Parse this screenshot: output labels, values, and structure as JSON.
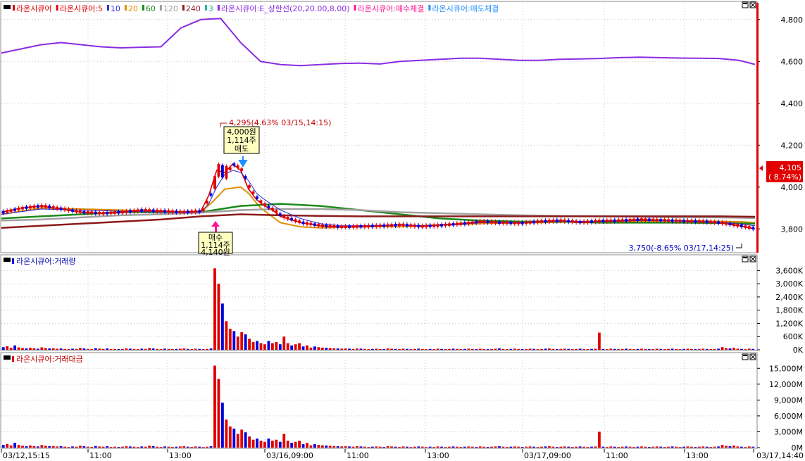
{
  "colors": {
    "up": "#e00000",
    "down": "#0000e0",
    "ma3": "#e00000",
    "ma5": "#e00000",
    "ma10": "#2a2ae0",
    "ma20": "#e09000",
    "ma60": "#1a8a1a",
    "ma120": "#a0a0a0",
    "ma240": "#8b1a1a",
    "upper_limit": "#8a2be2",
    "buy_marker": "#ff1493",
    "sell_marker": "#1e90ff",
    "grid": "#c8c8c8"
  },
  "legend": {
    "price": [
      {
        "text": "라온시큐어",
        "color": "#e00000"
      },
      {
        "text": "라온시큐어:5",
        "color": "#e00000"
      },
      {
        "text": "10",
        "color": "#2a2ae0"
      },
      {
        "text": "20",
        "color": "#e09000"
      },
      {
        "text": "60",
        "color": "#1a8a1a"
      },
      {
        "text": "120",
        "color": "#a0a0a0"
      },
      {
        "text": "240",
        "color": "#8b1a1a"
      },
      {
        "text": "3",
        "color": "#20b2aa"
      },
      {
        "text": "라온시큐어:E_상한선(20,20.00,8.00)",
        "color": "#8a2be2"
      },
      {
        "text": "라온시큐어:매수체결",
        "color": "#ff1493"
      },
      {
        "text": "라온시큐어:매도체결",
        "color": "#1e90ff"
      }
    ],
    "volume": "라온시큐어:거래량",
    "amount": "라온시큐어:거래대금"
  },
  "chart_data": [
    {
      "type": "line",
      "panel": "price",
      "y_axis_ticks": [
        "4,800",
        "4,600",
        "4,400",
        "4,200",
        "4,000",
        "3,800"
      ],
      "ylim": [
        3,
        690,
        4,
        880
      ],
      "current_price": "4,105",
      "current_change": "( 8.74%)",
      "high_label": "4,295(4.63% 03/15,14:15)",
      "low_label": "3,750(-8.65% 03/17,14:25)",
      "buy_annotation": [
        "매수",
        "1,114주",
        "4,140원"
      ],
      "sell_annotation": [
        "4,000원",
        "1,114주",
        "매도"
      ],
      "series": [
        {
          "name": "라온시큐어:E_상한선(20,20.00,8.00)",
          "x": [
            0,
            5,
            10,
            15,
            20,
            25,
            30,
            35,
            40,
            45,
            50,
            55,
            60,
            65,
            70,
            75,
            80,
            85,
            90,
            95,
            100,
            105,
            110,
            115,
            120,
            125,
            130,
            135,
            140,
            145,
            150,
            155,
            160,
            165,
            170,
            175,
            180,
            185,
            189
          ],
          "values": [
            4640,
            4660,
            4680,
            4690,
            4680,
            4670,
            4665,
            4668,
            4670,
            4760,
            4800,
            4805,
            4690,
            4600,
            4585,
            4580,
            4585,
            4590,
            4592,
            4588,
            4600,
            4605,
            4610,
            4615,
            4615,
            4610,
            4605,
            4605,
            4610,
            4612,
            4614,
            4618,
            4620,
            4618,
            4616,
            4615,
            4614,
            4605,
            4586
          ]
        },
        {
          "name": "20",
          "x": [
            0,
            10,
            20,
            30,
            40,
            50,
            53,
            56,
            60,
            62,
            65,
            70,
            75,
            80,
            85,
            90,
            95,
            100,
            105,
            110,
            115,
            120,
            125,
            130,
            135,
            140,
            145,
            150,
            155,
            160,
            165,
            170,
            175,
            180,
            185,
            189
          ],
          "values": [
            3870,
            3900,
            3895,
            3890,
            3885,
            3880,
            3930,
            3990,
            4000,
            3970,
            3900,
            3830,
            3810,
            3805,
            3808,
            3810,
            3812,
            3810,
            3815,
            3820,
            3822,
            3825,
            3828,
            3830,
            3830,
            3832,
            3835,
            3835,
            3834,
            3836,
            3838,
            3840,
            3838,
            3836,
            3835,
            3830
          ]
        },
        {
          "name": "60",
          "x": [
            0,
            10,
            20,
            30,
            40,
            50,
            60,
            70,
            80,
            90,
            100,
            110,
            120,
            130,
            140,
            150,
            160,
            170,
            180,
            189
          ],
          "values": [
            3850,
            3860,
            3870,
            3880,
            3880,
            3880,
            3910,
            3920,
            3910,
            3890,
            3870,
            3850,
            3840,
            3835,
            3835,
            3830,
            3830,
            3830,
            3828,
            3825
          ]
        },
        {
          "name": "120",
          "x": [
            0,
            10,
            20,
            30,
            40,
            50,
            60,
            70,
            80,
            90,
            100,
            110,
            120,
            130,
            140,
            150,
            160,
            170,
            180,
            189
          ],
          "values": [
            3840,
            3845,
            3855,
            3865,
            3870,
            3878,
            3890,
            3895,
            3895,
            3890,
            3880,
            3875,
            3870,
            3865,
            3862,
            3860,
            3858,
            3856,
            3855,
            3852
          ]
        },
        {
          "name": "240",
          "x": [
            0,
            10,
            20,
            30,
            40,
            50,
            60,
            70,
            80,
            90,
            100,
            110,
            120,
            130,
            140,
            150,
            160,
            170,
            180,
            189
          ],
          "values": [
            3805,
            3815,
            3825,
            3835,
            3845,
            3860,
            3870,
            3865,
            3862,
            3860,
            3860,
            3860,
            3860,
            3860,
            3860,
            3860,
            3860,
            3860,
            3860,
            3858
          ]
        },
        {
          "name": "라온시큐어:5",
          "x": [
            0,
            5,
            10,
            15,
            20,
            25,
            30,
            35,
            40,
            45,
            50,
            52,
            54,
            56,
            58,
            60,
            62,
            64,
            66,
            68,
            70,
            75,
            80,
            85,
            90,
            95,
            100,
            105,
            110,
            115,
            120,
            125,
            130,
            135,
            140,
            145,
            150,
            155,
            160,
            165,
            170,
            175,
            180,
            185,
            189
          ],
          "values": [
            3880,
            3900,
            3910,
            3895,
            3880,
            3875,
            3880,
            3890,
            3885,
            3880,
            3885,
            3960,
            4080,
            4070,
            4110,
            4080,
            3990,
            3940,
            3910,
            3890,
            3860,
            3830,
            3815,
            3810,
            3812,
            3815,
            3820,
            3812,
            3818,
            3825,
            3835,
            3830,
            3828,
            3836,
            3840,
            3832,
            3838,
            3840,
            3845,
            3842,
            3838,
            3836,
            3830,
            3815,
            3800
          ]
        },
        {
          "name": "10",
          "x": [
            0,
            10,
            20,
            30,
            40,
            50,
            52,
            54,
            56,
            58,
            60,
            62,
            64,
            66,
            68,
            70,
            75,
            80,
            85,
            90,
            95,
            100,
            105,
            110,
            115,
            120,
            125,
            130,
            135,
            140,
            145,
            150,
            155,
            160,
            165,
            170,
            175,
            180,
            185,
            189
          ],
          "values": [
            3870,
            3895,
            3890,
            3885,
            3880,
            3880,
            3920,
            4000,
            4060,
            4080,
            4070,
            4030,
            3970,
            3940,
            3915,
            3890,
            3850,
            3825,
            3815,
            3815,
            3816,
            3818,
            3816,
            3818,
            3822,
            3830,
            3832,
            3830,
            3834,
            3838,
            3836,
            3836,
            3838,
            3840,
            3840,
            3838,
            3836,
            3832,
            3824,
            3815
          ]
        }
      ]
    },
    {
      "type": "bar",
      "panel": "volume",
      "y_axis_ticks": [
        "3,600K",
        "3,000K",
        "2,400K",
        "1,800K",
        "1,200K",
        "600K",
        "0K"
      ],
      "ylim": [
        0,
        3900
      ],
      "units": "K",
      "values": [
        120,
        160,
        90,
        200,
        110,
        80,
        60,
        90,
        70,
        50,
        110,
        80,
        60,
        70,
        50,
        60,
        40,
        30,
        50,
        40,
        80,
        60,
        40,
        30,
        70,
        50,
        40,
        60,
        30,
        40,
        30,
        40,
        60,
        50,
        40,
        30,
        50,
        40,
        80,
        60,
        40,
        30,
        50,
        40,
        30,
        40,
        50,
        60,
        40,
        30,
        50,
        40,
        30,
        40,
        60,
        3700,
        3000,
        2100,
        1300,
        950,
        850,
        600,
        800,
        700,
        500,
        350,
        400,
        300,
        250,
        400,
        300,
        350,
        250,
        600,
        300,
        200,
        250,
        300,
        150,
        200,
        100,
        150,
        120,
        100,
        90,
        80,
        70,
        60,
        50,
        60,
        50,
        40,
        60,
        50,
        40,
        30,
        40,
        50,
        40,
        30,
        60,
        50,
        40,
        30,
        50,
        40,
        30,
        40,
        50,
        40,
        30,
        40,
        30,
        50,
        40,
        30,
        40,
        50,
        40,
        30,
        40,
        50,
        40,
        30,
        50,
        40,
        30,
        40,
        50,
        60,
        40,
        30,
        40,
        50,
        40,
        30,
        40,
        50,
        40,
        30,
        40,
        50,
        60,
        40,
        30,
        40,
        50,
        40,
        30,
        40,
        50,
        40,
        30,
        40,
        50,
        780,
        40,
        30,
        50,
        40,
        30,
        40,
        50,
        40,
        30,
        40,
        50,
        40,
        30,
        40,
        50,
        40,
        30,
        40,
        50,
        40,
        30,
        40,
        50,
        40,
        30,
        40,
        50,
        40,
        30,
        40,
        50,
        120,
        80,
        60,
        90,
        50,
        40,
        30,
        50,
        40
      ],
      "colors": "ud"
    },
    {
      "type": "bar",
      "panel": "amount",
      "y_axis_ticks": [
        "15,000M",
        "12,000M",
        "9,000M",
        "6,000M",
        "3,000M",
        "0M"
      ],
      "ylim": [
        0,
        16500
      ],
      "units": "M",
      "values": [
        500,
        700,
        400,
        900,
        500,
        350,
        260,
        400,
        300,
        220,
        480,
        350,
        260,
        300,
        220,
        260,
        180,
        130,
        220,
        180,
        350,
        260,
        180,
        130,
        300,
        220,
        180,
        260,
        130,
        180,
        130,
        180,
        260,
        220,
        180,
        130,
        220,
        180,
        350,
        260,
        180,
        130,
        220,
        180,
        130,
        180,
        220,
        260,
        180,
        130,
        220,
        180,
        130,
        180,
        260,
        15500,
        13000,
        8500,
        5300,
        4000,
        3600,
        2600,
        3400,
        2900,
        2100,
        1500,
        1700,
        1300,
        1100,
        1700,
        1300,
        1500,
        1100,
        2600,
        1300,
        900,
        1100,
        1300,
        650,
        900,
        430,
        650,
        520,
        430,
        390,
        350,
        300,
        260,
        220,
        260,
        220,
        180,
        260,
        220,
        180,
        130,
        180,
        220,
        180,
        130,
        260,
        220,
        180,
        130,
        220,
        180,
        130,
        180,
        220,
        180,
        130,
        180,
        130,
        220,
        180,
        130,
        180,
        220,
        180,
        130,
        180,
        220,
        180,
        130,
        220,
        180,
        130,
        180,
        220,
        260,
        180,
        130,
        180,
        220,
        180,
        130,
        180,
        220,
        180,
        130,
        180,
        220,
        260,
        180,
        130,
        180,
        220,
        180,
        130,
        180,
        220,
        180,
        130,
        180,
        220,
        3000,
        180,
        130,
        220,
        180,
        130,
        180,
        220,
        180,
        130,
        180,
        220,
        180,
        130,
        180,
        220,
        180,
        130,
        180,
        220,
        180,
        130,
        180,
        220,
        180,
        130,
        180,
        220,
        180,
        130,
        180,
        220,
        500,
        350,
        260,
        390,
        220,
        180,
        130,
        220,
        180
      ]
    }
  ],
  "x_axis_labels": [
    "03/12,15:15",
    "11:00",
    "13:00",
    "03/16,09:00",
    "11:00",
    "13:00",
    "03/17,09:00",
    "11:00",
    "13:00",
    "03/17,14:40"
  ]
}
